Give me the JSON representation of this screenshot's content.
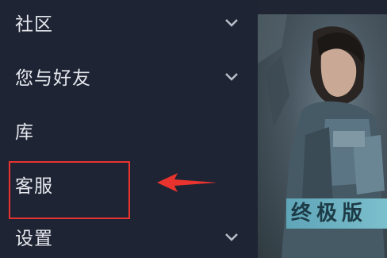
{
  "menu": {
    "items": [
      {
        "label": "社区",
        "has_chevron": true
      },
      {
        "label": "您与好友",
        "has_chevron": true
      },
      {
        "label": "库",
        "has_chevron": false
      },
      {
        "label": "客服",
        "has_chevron": false
      },
      {
        "label": "设置",
        "has_chevron": true
      }
    ]
  },
  "art": {
    "banner_text": "终极版"
  },
  "colors": {
    "sidebar_bg": "#1e2433",
    "highlight": "#e8332e",
    "arrow": "#e8332e"
  }
}
